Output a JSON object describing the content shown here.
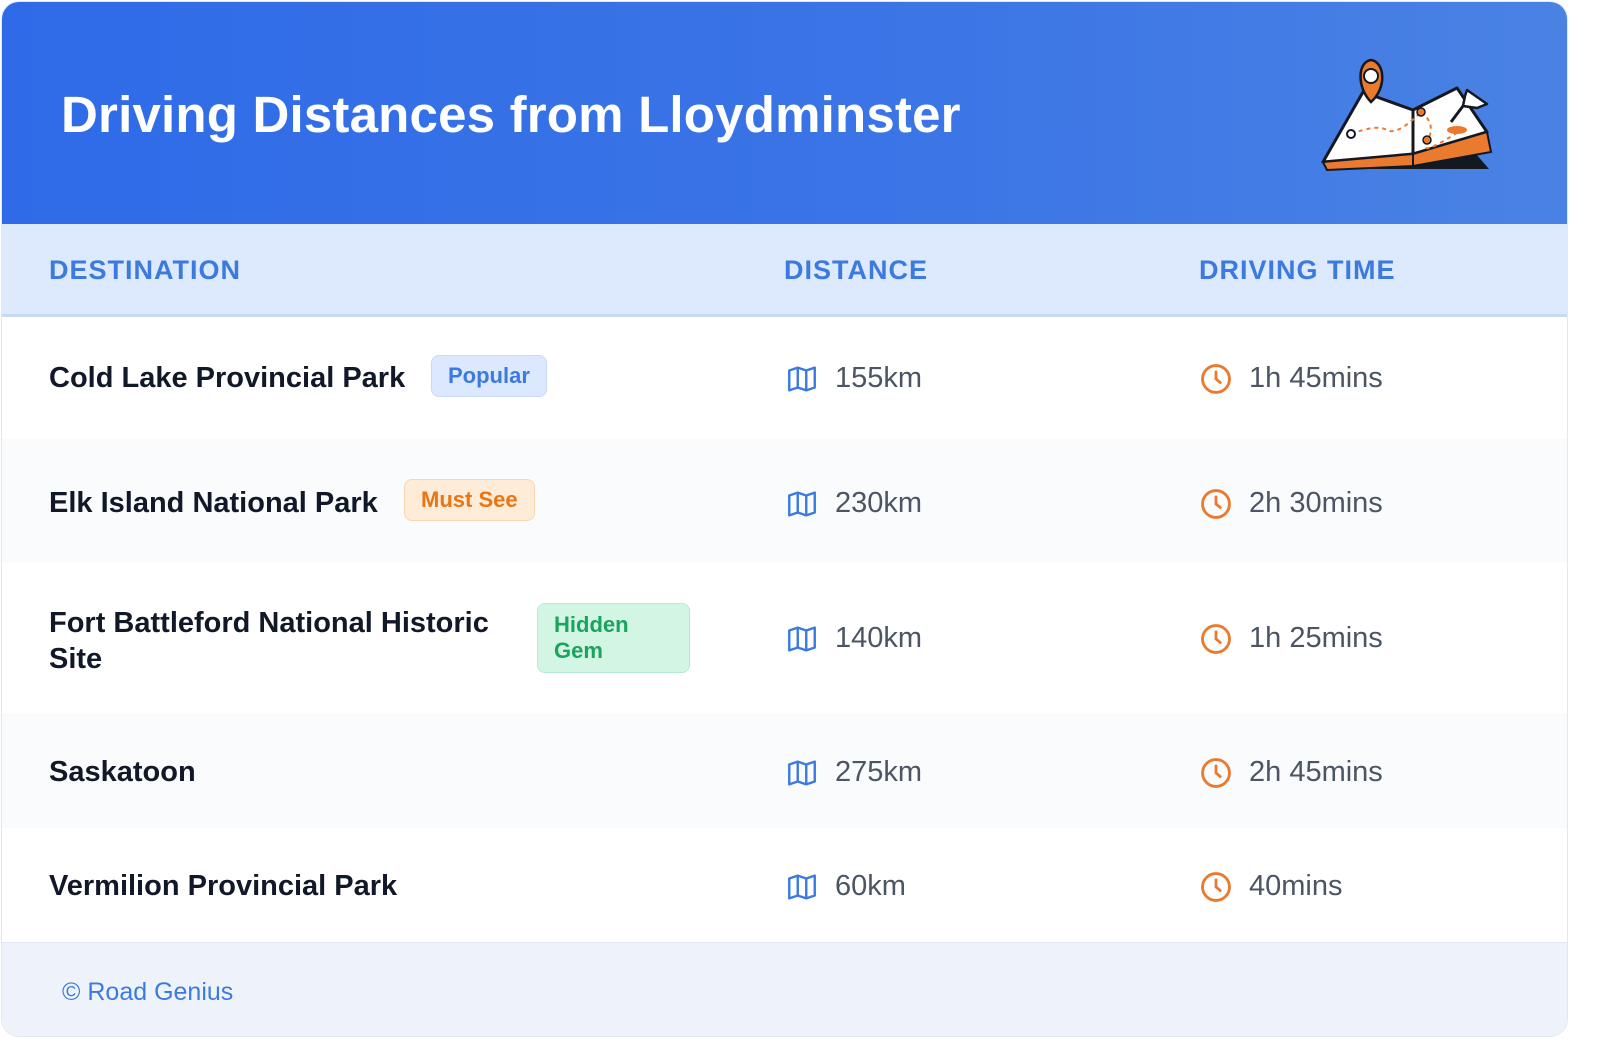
{
  "header": {
    "title": "Driving Distances from Lloydminster",
    "illustration_icon": "map-pin-illustration-icon"
  },
  "table": {
    "columns": [
      "DESTINATION",
      "DISTANCE",
      "DRIVING TIME"
    ],
    "rows": [
      {
        "destination": "Cold Lake Provincial Park",
        "badge": "Popular",
        "badge_type": "popular",
        "distance": "155km",
        "time": "1h 45mins"
      },
      {
        "destination": "Elk Island National Park",
        "badge": "Must See",
        "badge_type": "mustsee",
        "distance": "230km",
        "time": "2h 30mins"
      },
      {
        "destination": "Fort Battleford National Historic Site",
        "badge": "Hidden Gem",
        "badge_type": "hidden",
        "distance": "140km",
        "time": "1h 25mins"
      },
      {
        "destination": "Saskatoon",
        "badge": "",
        "badge_type": "",
        "distance": "275km",
        "time": "2h 45mins"
      },
      {
        "destination": "Vermilion Provincial Park",
        "badge": "",
        "badge_type": "",
        "distance": "60km",
        "time": "40mins"
      }
    ]
  },
  "icons": {
    "distance": "map-icon",
    "time": "clock-icon"
  },
  "colors": {
    "header_start": "#2f6be8",
    "header_end": "#4a82e4",
    "accent_blue": "#3c7ae0",
    "accent_orange": "#ea7514",
    "accent_green": "#1aa45e"
  },
  "footer": {
    "text": "© Road Genius"
  }
}
